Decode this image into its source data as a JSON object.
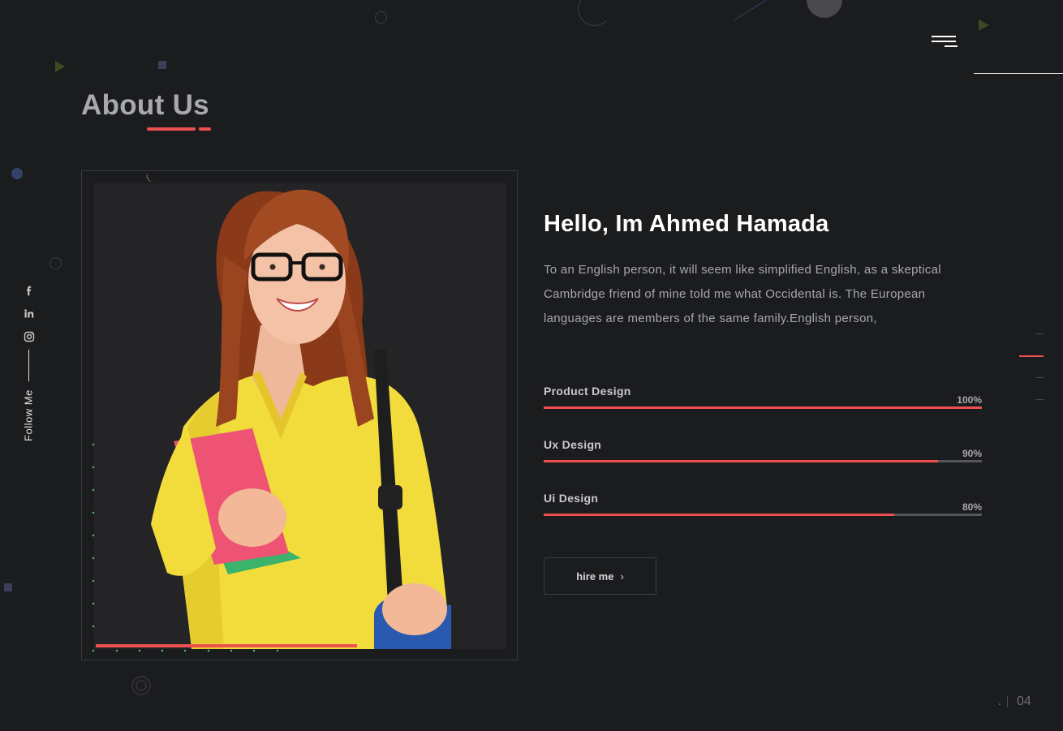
{
  "header": {
    "menu_icon": "hamburger-menu-icon"
  },
  "section": {
    "title": "About Us",
    "accent_color": "#ee4f4f"
  },
  "social": {
    "icons": [
      {
        "name": "facebook-icon",
        "glyph": "f"
      },
      {
        "name": "linkedin-icon",
        "glyph": "in"
      },
      {
        "name": "instagram-icon",
        "glyph": "◎"
      }
    ],
    "follow_label": "Follow Me"
  },
  "photo": {
    "subject": "person-photo"
  },
  "about": {
    "greeting": "Hello, Im Ahmed Hamada",
    "bio": "To an English person, it will seem like simplified English, as a skeptical Cambridge friend of mine told me what Occidental is. The European languages are members of the same family.English person,"
  },
  "skills": [
    {
      "label": "Product Design",
      "percent_label": "100%",
      "value": 100
    },
    {
      "label": "Ux Design",
      "percent_label": "90%",
      "value": 90
    },
    {
      "label": "Ui Design",
      "percent_label": "80%",
      "value": 80
    }
  ],
  "cta": {
    "label": "hire me",
    "icon": "chevron-right-icon"
  },
  "pagination": {
    "current": "04"
  }
}
